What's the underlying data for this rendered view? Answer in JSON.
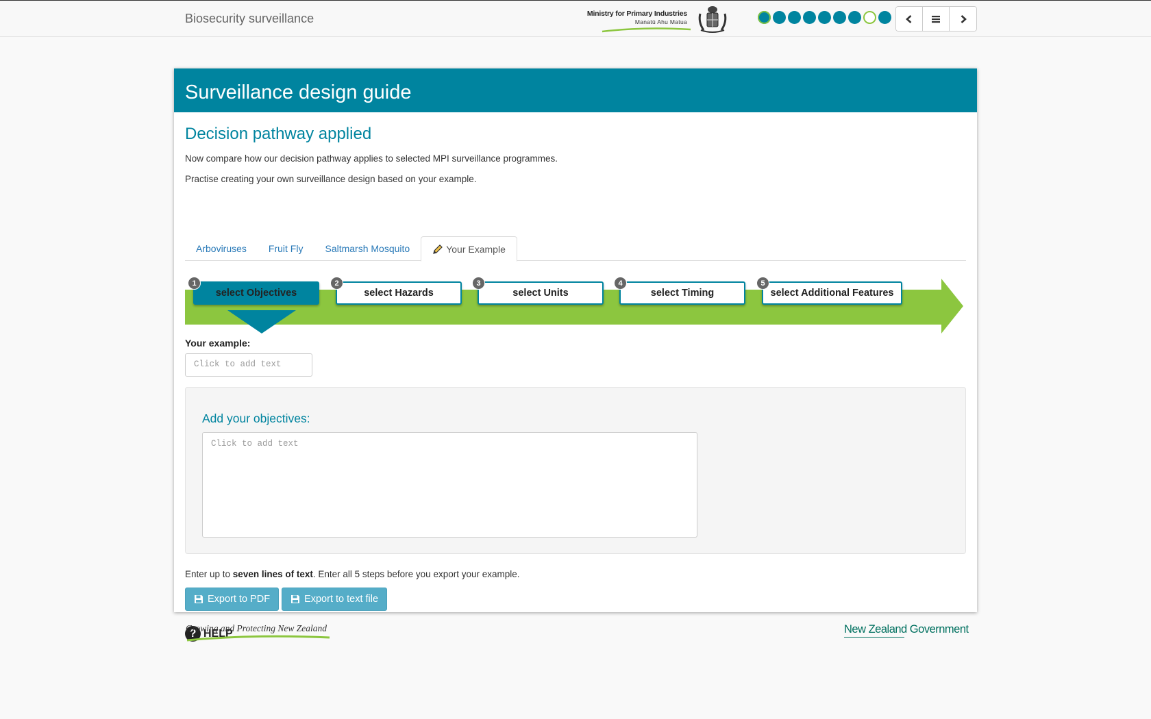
{
  "header": {
    "site_title": "Biosecurity surveillance",
    "logo": {
      "line1": "Ministry for Primary Industries",
      "line2": "Manatū Ahu Matua"
    },
    "progress_dots": [
      "current",
      "filled",
      "filled",
      "filled",
      "filled",
      "filled",
      "filled",
      "hollow",
      "filled"
    ],
    "nav": {
      "prev_icon": "chevron-left-icon",
      "menu_icon": "menu-icon",
      "next_icon": "chevron-right-icon"
    }
  },
  "card": {
    "title": "Surveillance design guide",
    "section_title": "Decision pathway applied",
    "intro1": "Now compare how our decision pathway applies to selected MPI surveillance programmes.",
    "intro2": "Practise creating your own surveillance design based on your example.",
    "tabs": [
      {
        "label": "Arboviruses",
        "active": false
      },
      {
        "label": "Fruit Fly",
        "active": false
      },
      {
        "label": "Saltmarsh Mosquito",
        "active": false
      },
      {
        "label": "Your Example",
        "active": true
      }
    ],
    "steps": [
      {
        "num": "1",
        "label": "select Objectives",
        "active": true
      },
      {
        "num": "2",
        "label": "select Hazards",
        "active": false
      },
      {
        "num": "3",
        "label": "select Units",
        "active": false
      },
      {
        "num": "4",
        "label": "select Timing",
        "active": false
      },
      {
        "num": "5",
        "label": "select Additional Features",
        "active": false
      }
    ],
    "example_label": "Your example:",
    "example_placeholder": "Click to add text",
    "objectives_title": "Add your objectives:",
    "objectives_placeholder": "Click to add text",
    "instructions": {
      "pre": "Enter up to ",
      "bold": "seven lines of text",
      "post": ". Enter all 5 steps before you export your example."
    },
    "buttons": {
      "export_pdf": "Export to PDF",
      "export_text": "Export to text file"
    },
    "help": "HELP"
  },
  "footer": {
    "left": "Growing and Protecting New Zealand",
    "right": "New Zealand Government"
  },
  "colors": {
    "teal": "#00849f",
    "green": "#8cc63f",
    "button": "#55adc8"
  }
}
